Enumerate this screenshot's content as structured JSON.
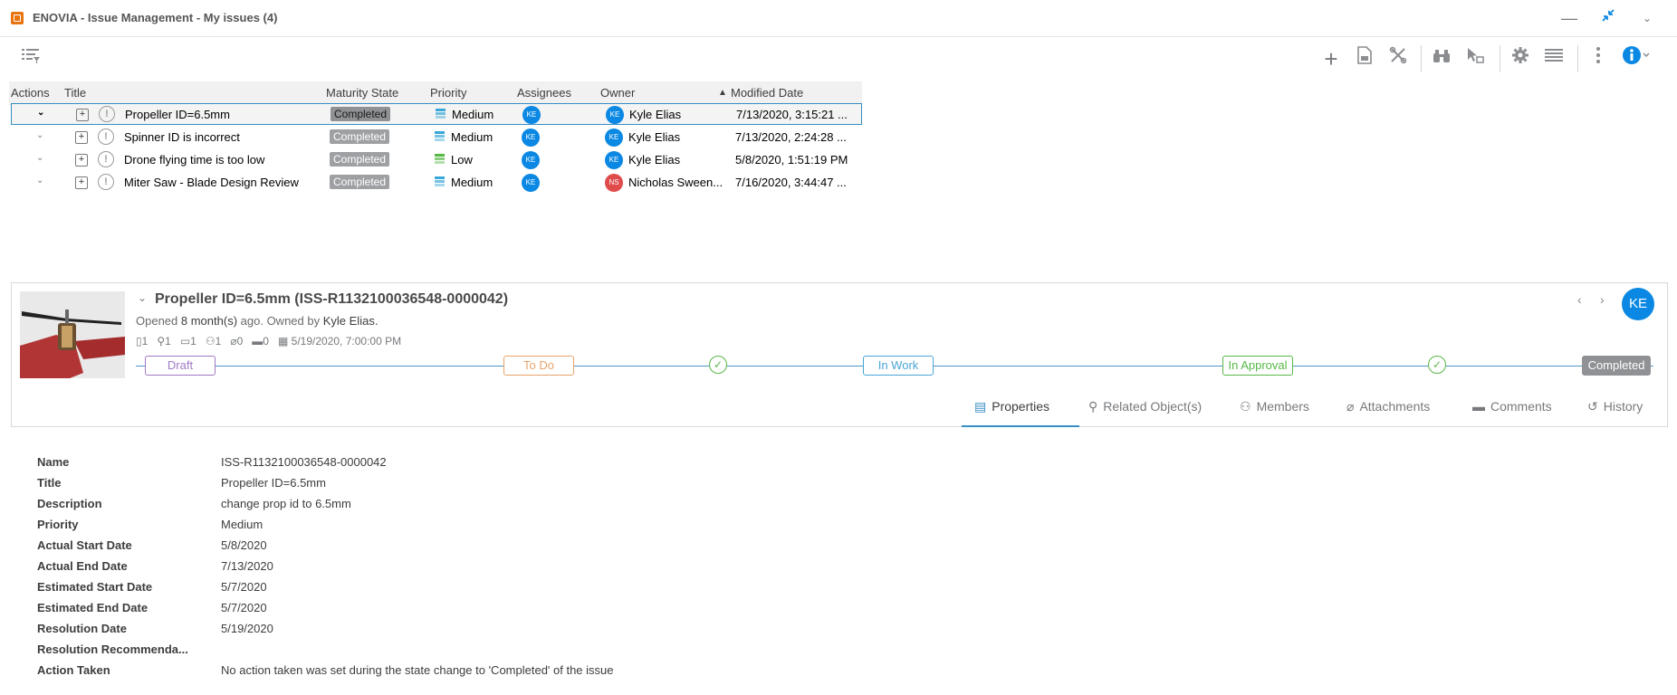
{
  "window": {
    "title": "ENOVIA - Issue Management - My issues (4)",
    "minimize_icon": "minimize-icon",
    "collapse_icon": "collapse-arrows-icon",
    "menu_icon": "chevron-down-icon"
  },
  "toolbar": {
    "filter_icon": "list-filter-icon",
    "add_icon": "plus-icon",
    "export_icon": "document-export-icon",
    "tools_icon": "tools-icon",
    "find_icon": "binoculars-icon",
    "select_icon": "cursor-select-icon",
    "settings_icon": "gear-icon",
    "view_icon": "list-view-icon",
    "more_icon": "vertical-dots-icon",
    "info_icon": "info-icon"
  },
  "table": {
    "headers": {
      "actions": "Actions",
      "title": "Title",
      "maturity": "Maturity State",
      "priority": "Priority",
      "assignees": "Assignees",
      "owner": "Owner",
      "modified": "Modified Date",
      "sort_indicator": "▲"
    },
    "rows": [
      {
        "title": "Propeller ID=6.5mm",
        "maturity": "Completed",
        "priority": "Medium",
        "priority_color": "#3aa8d8",
        "assignee": "KE",
        "owner_initials": "KE",
        "owner_color": "#0a88e3",
        "owner": "Kyle Elias",
        "modified": "7/13/2020, 3:15:21 ..."
      },
      {
        "title": "Spinner ID is incorrect",
        "maturity": "Completed",
        "priority": "Medium",
        "priority_color": "#3aa8d8",
        "assignee": "KE",
        "owner_initials": "KE",
        "owner_color": "#0a88e3",
        "owner": "Kyle Elias",
        "modified": "7/13/2020, 2:24:28 ..."
      },
      {
        "title": "Drone flying time is too low",
        "maturity": "Completed",
        "priority": "Low",
        "priority_color": "#57b847",
        "assignee": "KE",
        "owner_initials": "KE",
        "owner_color": "#0a88e3",
        "owner": "Kyle Elias",
        "modified": "5/8/2020, 1:51:19 PM"
      },
      {
        "title": "Miter Saw - Blade Design Review",
        "maturity": "Completed",
        "priority": "Medium",
        "priority_color": "#3aa8d8",
        "assignee": "KE",
        "owner_initials": "NS",
        "owner_color": "#e04c4c",
        "owner": "Nicholas Sween...",
        "modified": "7/16/2020, 3:44:47 ..."
      }
    ]
  },
  "detail": {
    "title": "Propeller ID=6.5mm (ISS-R1132100036548-0000042)",
    "opened_prefix": "Opened",
    "opened_age": "8 month(s)",
    "opened_mid": "ago. Owned by",
    "owner": "Kyle Elias.",
    "meta": {
      "docs": "1",
      "locations": "1",
      "files": "1",
      "members": "1",
      "attachments": "0",
      "comments": "0",
      "date": "5/19/2020, 7:00:00 PM"
    },
    "owner_initials": "KE",
    "stages": {
      "draft": "Draft",
      "todo": "To Do",
      "inwork": "In Work",
      "inapproval": "In Approval",
      "completed": "Completed"
    }
  },
  "tabs": {
    "properties": "Properties",
    "related": "Related Object(s)",
    "members": "Members",
    "attachments": "Attachments",
    "comments": "Comments",
    "history": "History"
  },
  "properties": [
    {
      "label": "Name",
      "value": "ISS-R1132100036548-0000042"
    },
    {
      "label": "Title",
      "value": "Propeller ID=6.5mm"
    },
    {
      "label": "Description",
      "value": "change prop id to 6.5mm"
    },
    {
      "label": "Priority",
      "value": "Medium"
    },
    {
      "label": "Actual Start Date",
      "value": "5/8/2020"
    },
    {
      "label": "Actual End Date",
      "value": "7/13/2020"
    },
    {
      "label": "Estimated Start Date",
      "value": "5/7/2020"
    },
    {
      "label": "Estimated End Date",
      "value": "5/7/2020"
    },
    {
      "label": "Resolution Date",
      "value": "5/19/2020"
    },
    {
      "label": "Resolution Recommenda...",
      "value": ""
    },
    {
      "label": "Action Taken",
      "value": "No action taken was set during the state change to 'Completed' of the issue"
    }
  ]
}
